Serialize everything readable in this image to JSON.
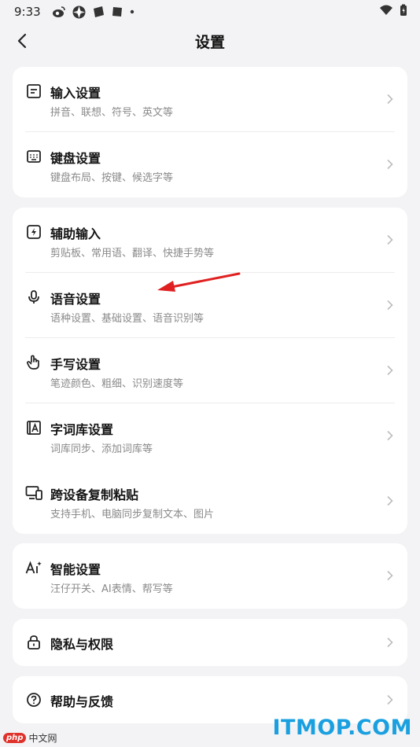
{
  "status": {
    "time": "9:33"
  },
  "header": {
    "title": "设置"
  },
  "cards": [
    {
      "items": [
        {
          "icon": "input-settings-icon",
          "title": "输入设置",
          "subtitle": "拼音、联想、符号、英文等"
        },
        {
          "icon": "keyboard-icon",
          "title": "键盘设置",
          "subtitle": "键盘布局、按键、候选字等"
        }
      ]
    },
    {
      "items": [
        {
          "icon": "assist-input-icon",
          "title": "辅助输入",
          "subtitle": "剪贴板、常用语、翻译、快捷手势等"
        },
        {
          "icon": "microphone-icon",
          "title": "语音设置",
          "subtitle": "语种设置、基础设置、语音识别等"
        },
        {
          "icon": "handwriting-icon",
          "title": "手写设置",
          "subtitle": "笔迹颜色、粗细、识别速度等"
        },
        {
          "icon": "dictionary-icon",
          "title": "字词库设置",
          "subtitle": "词库同步、添加词库等"
        },
        {
          "icon": "cross-device-icon",
          "title": "跨设备复制粘贴",
          "subtitle": "支持手机、电脑同步复制文本、图片"
        }
      ]
    },
    {
      "items": [
        {
          "icon": "ai-icon",
          "title": "智能设置",
          "subtitle": "汪仔开关、AI表情、帮写等"
        }
      ]
    },
    {
      "items": [
        {
          "icon": "lock-icon",
          "title": "隐私与权限"
        }
      ]
    },
    {
      "items": [
        {
          "icon": "help-icon",
          "title": "帮助与反馈"
        }
      ]
    }
  ],
  "watermarks": {
    "left_php": "php",
    "left_text": "中文网",
    "right": "ITMOP.COM"
  },
  "colors": {
    "background": "#f3f3f5",
    "card": "#ffffff",
    "annotation_arrow": "#e02020",
    "watermark_blue": "#1aa0e0"
  }
}
